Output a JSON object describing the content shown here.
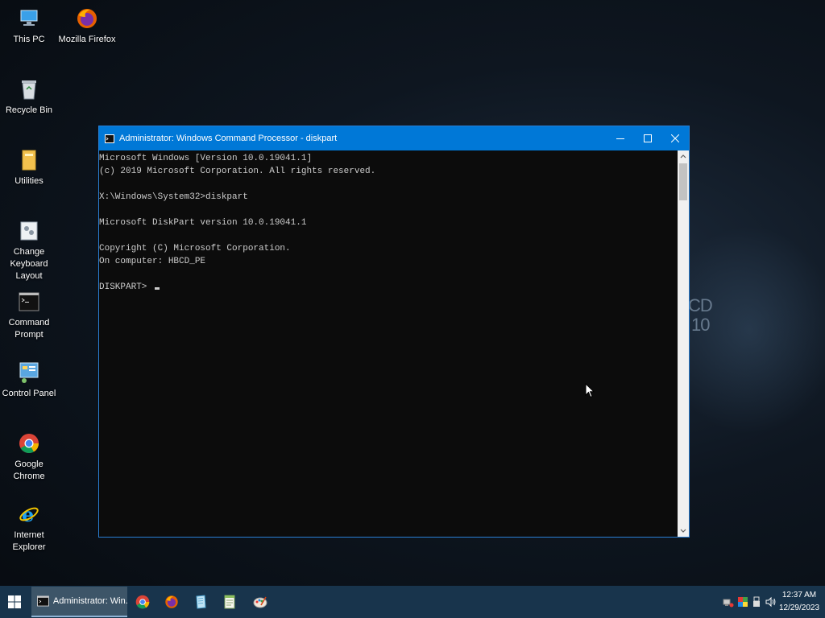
{
  "desktop": {
    "icons": [
      {
        "label": "This PC",
        "icon": "this-pc-icon"
      },
      {
        "label": "Mozilla Firefox",
        "icon": "firefox-icon"
      },
      {
        "label": "Recycle Bin",
        "icon": "recycle-bin-icon"
      },
      {
        "label": "Utilities",
        "icon": "folder-icon"
      },
      {
        "label": "Change Keyboard Layout",
        "icon": "keyboard-layout-icon"
      },
      {
        "label": "Command Prompt",
        "icon": "command-prompt-icon"
      },
      {
        "label": "Control Panel",
        "icon": "control-panel-icon"
      },
      {
        "label": "Google Chrome",
        "icon": "chrome-icon"
      },
      {
        "label": "Internet Explorer",
        "icon": "internet-explorer-icon"
      }
    ],
    "wallpaper_text": {
      "line1": "CD",
      "line2": "10"
    }
  },
  "window": {
    "title": "Administrator: Windows Command Processor - diskpart",
    "console_lines": [
      "Microsoft Windows [Version 10.0.19041.1]",
      "(c) 2019 Microsoft Corporation. All rights reserved.",
      "",
      "X:\\Windows\\System32>diskpart",
      "",
      "Microsoft DiskPart version 10.0.19041.1",
      "",
      "Copyright (C) Microsoft Corporation.",
      "On computer: HBCD_PE",
      "",
      "DISKPART> "
    ],
    "colors": {
      "titlebar": "#0078d7",
      "console_bg": "#0c0c0c",
      "console_text": "#cccccc"
    }
  },
  "taskbar": {
    "active_task_label": "Administrator: Win...",
    "pinned": [
      "chrome-icon",
      "firefox-icon",
      "file-explorer-icon",
      "notepad-icon",
      "paint-icon"
    ],
    "tray": [
      "network-icon",
      "color-icon",
      "usb-icon",
      "volume-icon"
    ],
    "time": "12:37 AM",
    "date": "12/29/2023",
    "color": "#18344c"
  }
}
